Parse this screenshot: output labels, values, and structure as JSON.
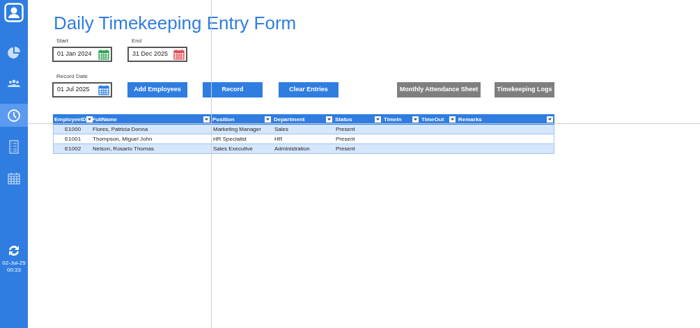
{
  "sidebar": {
    "items": [
      {
        "kind": "chart",
        "selected": false
      },
      {
        "kind": "people",
        "selected": false
      },
      {
        "kind": "clock",
        "selected": true
      },
      {
        "kind": "checklist",
        "selected": false
      },
      {
        "kind": "calendar",
        "selected": false
      }
    ],
    "date": "02-Jul-25",
    "time": "00:33"
  },
  "title": "Daily Timekeeping Entry Form",
  "date_fields": [
    {
      "label": "Start",
      "value": "01 Jan 2024",
      "color": "#2ea44f"
    },
    {
      "label": "End",
      "value": "31 Dec 2025",
      "color": "#e5484d"
    },
    {
      "label": "Record Date",
      "value": "01 Jul 2025",
      "color": "#2f7de1"
    }
  ],
  "buttons": [
    {
      "label": "Add Employees",
      "kind": "primary"
    },
    {
      "label": "Record",
      "kind": "primary"
    },
    {
      "label": "Clear Entries",
      "kind": "primary"
    },
    {
      "label": "Monthly Attendance Sheet",
      "kind": "secondary"
    },
    {
      "label": "Timekeeping Logs",
      "kind": "secondary"
    }
  ],
  "table": {
    "columns": [
      "EmployeeID",
      "FullName",
      "Position",
      "Department",
      "Status",
      "TimeIn",
      "TimeOut",
      "Remarks"
    ],
    "rows": [
      [
        "E1000",
        "Flores, Patricia Donna",
        "Marketing Manager",
        "Sales",
        "Present",
        "",
        "",
        ""
      ],
      [
        "E1001",
        "Thompson, Miguel John",
        "HR Specialist",
        "HR",
        "Present",
        "",
        "",
        ""
      ],
      [
        "E1002",
        "Nelson, Rosario Thomas",
        "Sales Executive",
        "Administration",
        "Present",
        "",
        "",
        ""
      ]
    ]
  }
}
